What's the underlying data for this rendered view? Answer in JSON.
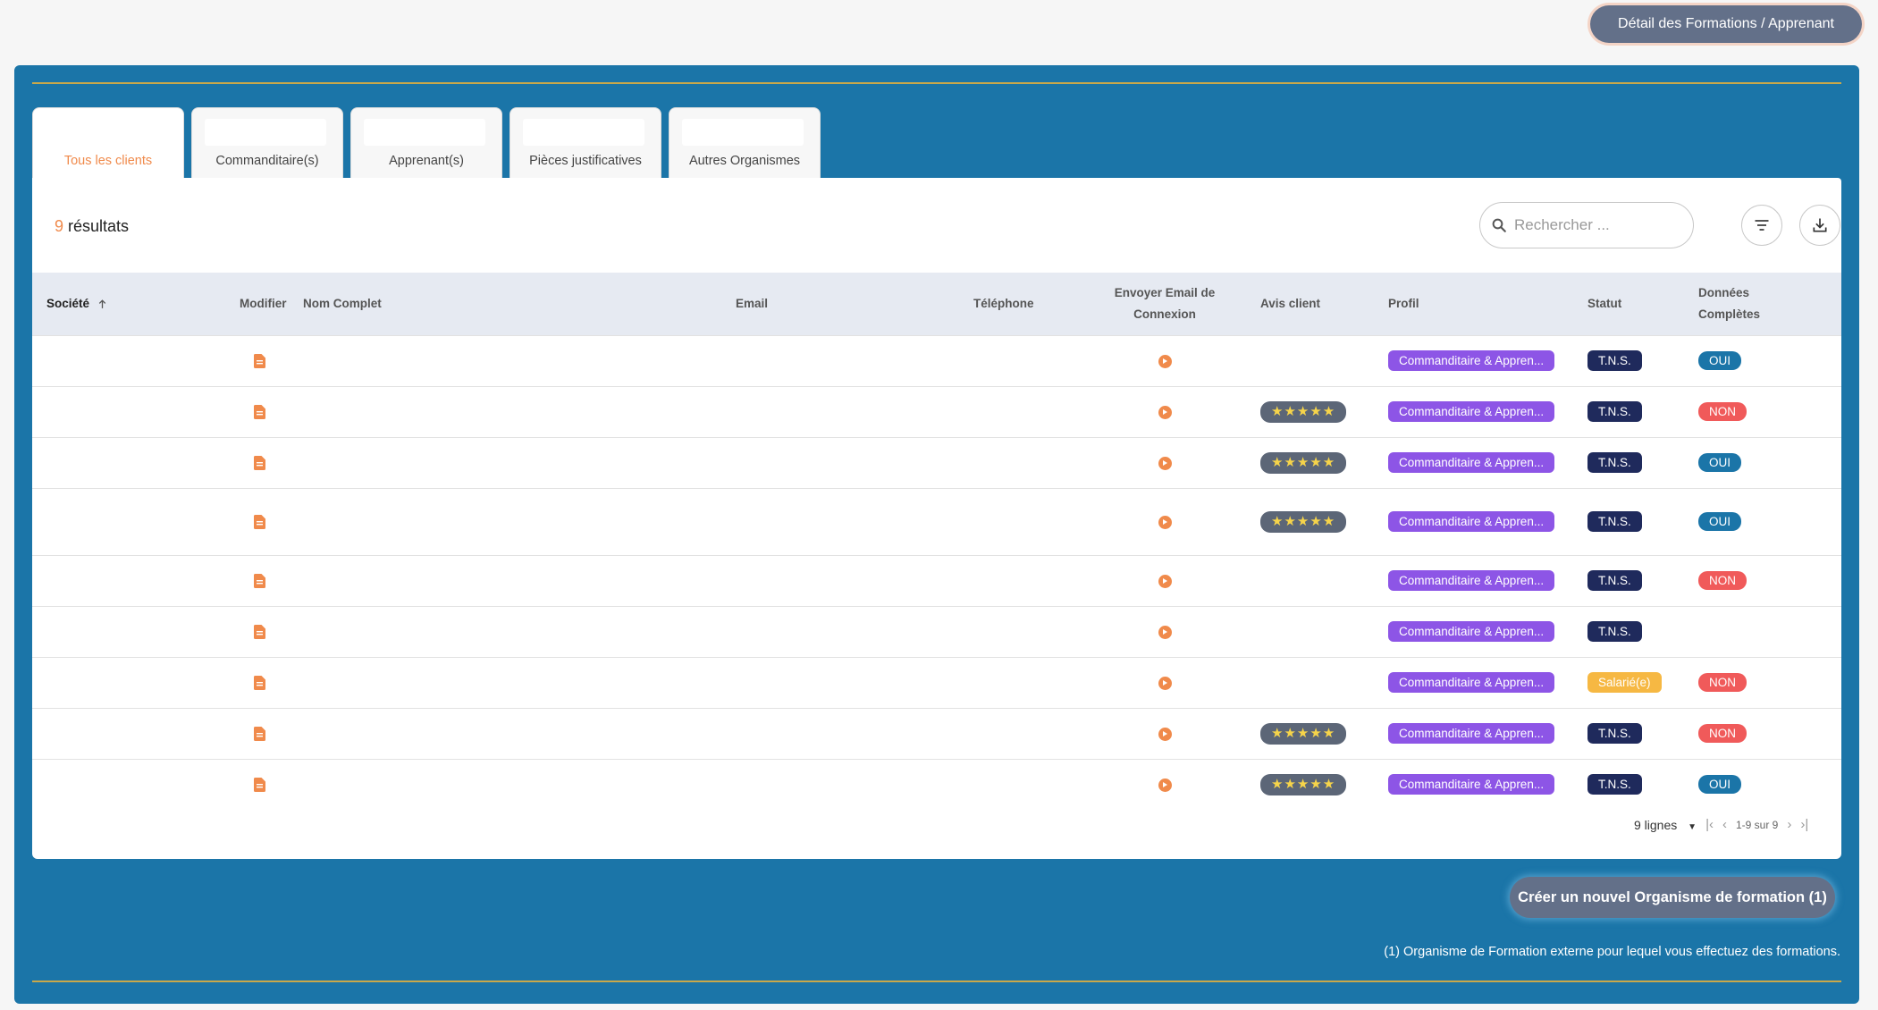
{
  "header": {
    "detail_button": "Détail des Formations / Apprenant"
  },
  "tabs": [
    {
      "label": "Tous les clients"
    },
    {
      "label": "Commanditaire(s)"
    },
    {
      "label": "Apprenant(s)"
    },
    {
      "label": "Pièces justificatives"
    },
    {
      "label": "Autres Organismes"
    }
  ],
  "results": {
    "count": "9",
    "label": " résultats"
  },
  "search": {
    "placeholder": "Rechercher ..."
  },
  "columns": {
    "societe": "Société",
    "modifier": "Modifier",
    "nom": "Nom Complet",
    "email": "Email",
    "telephone": "Téléphone",
    "envoyer_1": "Envoyer Email de",
    "envoyer_2": "Connexion",
    "avis": "Avis client",
    "profil": "Profil",
    "statut": "Statut",
    "donnees_1": "Données",
    "donnees_2": "Complètes"
  },
  "rows": [
    {
      "stars": "",
      "profil": "Commanditaire & Appren...",
      "statut": "T.N.S.",
      "complete": "OUI"
    },
    {
      "stars": "★★★★★",
      "profil": "Commanditaire & Appren...",
      "statut": "T.N.S.",
      "complete": "NON"
    },
    {
      "stars": "★★★★★",
      "profil": "Commanditaire & Appren...",
      "statut": "T.N.S.",
      "complete": "OUI"
    },
    {
      "stars": "★★★★★",
      "profil": "Commanditaire & Appren...",
      "statut": "T.N.S.",
      "complete": "OUI"
    },
    {
      "stars": "",
      "profil": "Commanditaire & Appren...",
      "statut": "T.N.S.",
      "complete": "NON"
    },
    {
      "stars": "",
      "profil": "Commanditaire & Appren...",
      "statut": "T.N.S.",
      "complete": ""
    },
    {
      "stars": "",
      "profil": "Commanditaire & Appren...",
      "statut": "Salarié(e)",
      "complete": "NON"
    },
    {
      "stars": "★★★★★",
      "profil": "Commanditaire & Appren...",
      "statut": "T.N.S.",
      "complete": "NON"
    },
    {
      "stars": "★★★★★",
      "profil": "Commanditaire & Appren...",
      "statut": "T.N.S.",
      "complete": "OUI"
    }
  ],
  "pagination": {
    "rows_per_page": "9 lignes",
    "range": "1-9 sur 9"
  },
  "footer": {
    "create_button": "Créer un nouvel Organisme de formation (1)",
    "footnote": "(1) Organisme de Formation externe pour lequel vous effectuez des formations."
  },
  "colors": {
    "panel": "#1b75a8",
    "accent": "#f08a4b",
    "gold": "#c9a84a",
    "profile": "#8d55e6",
    "tns": "#1f2a5c",
    "salarie": "#f6b843",
    "oui": "#1b75a8",
    "non": "#f05a5a"
  }
}
